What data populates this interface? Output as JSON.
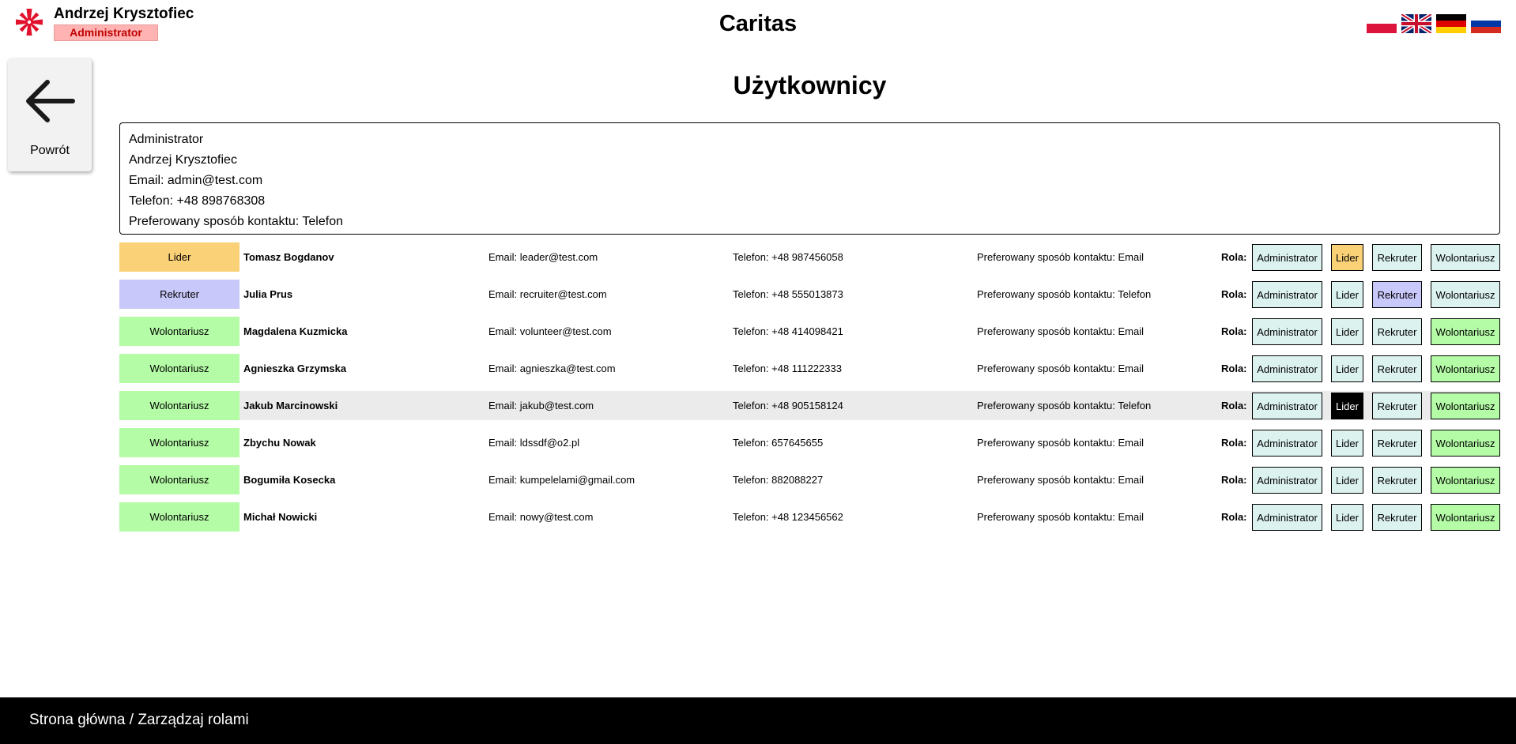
{
  "header": {
    "user_name": "Andrzej Krysztofiec",
    "user_role": "Administrator",
    "app_title": "Caritas",
    "languages": [
      "Polski",
      "English",
      "Deutsch",
      "Русский"
    ]
  },
  "back": {
    "label": "Powrót"
  },
  "page_title": "Użytkownicy",
  "current_user": {
    "role": "Administrator",
    "name": "Andrzej Krysztofiec",
    "email": "Email: admin@test.com",
    "phone": "Telefon: +48 898768308",
    "preferred": "Preferowany sposób kontaktu: Telefon"
  },
  "role_buttons": {
    "admin": "Administrator",
    "lider": "Lider",
    "rekruter": "Rekruter",
    "wolontariusz": "Wolontariusz"
  },
  "rola_label": "Rola:",
  "users": [
    {
      "role": "Lider",
      "name": "Tomasz Bogdanov",
      "email": "Email: leader@test.com",
      "phone": "Telefon: +48 987456058",
      "preferred": "Preferowany sposób kontaktu: Email"
    },
    {
      "role": "Rekruter",
      "name": "Julia Prus",
      "email": "Email: recruiter@test.com",
      "phone": "Telefon: +48 555013873",
      "preferred": "Preferowany sposób kontaktu: Telefon"
    },
    {
      "role": "Wolontariusz",
      "name": "Magdalena Kuzmicka",
      "email": "Email: volunteer@test.com",
      "phone": "Telefon: +48 414098421",
      "preferred": "Preferowany sposób kontaktu: Email"
    },
    {
      "role": "Wolontariusz",
      "name": "Agnieszka Grzymska",
      "email": "Email: agnieszka@test.com",
      "phone": "Telefon: +48 111222333",
      "preferred": "Preferowany sposób kontaktu: Email"
    },
    {
      "role": "Wolontariusz",
      "name": "Jakub Marcinowski",
      "email": "Email: jakub@test.com",
      "phone": "Telefon: +48 905158124",
      "preferred": "Preferowany sposób kontaktu: Telefon"
    },
    {
      "role": "Wolontariusz",
      "name": "Zbychu Nowak",
      "email": "Email: ldssdf@o2.pl",
      "phone": "Telefon: 657645655",
      "preferred": "Preferowany sposób kontaktu: Email"
    },
    {
      "role": "Wolontariusz",
      "name": "Bogumiła Kosecka",
      "email": "Email: kumpelelami@gmail.com",
      "phone": "Telefon: 882088227",
      "preferred": "Preferowany sposób kontaktu: Email"
    },
    {
      "role": "Wolontariusz",
      "name": "Michał Nowicki",
      "email": "Email: nowy@test.com",
      "phone": "Telefon: +48 123456562",
      "preferred": "Preferowany sposób kontaktu: Email"
    }
  ],
  "colors": {
    "lider": "#fad177",
    "rekruter": "#c9c8fb",
    "wolontariusz": "#b4fca6",
    "button_default": "#dcf2ef",
    "admin_badge": "#ffb3b3",
    "logo_red": "#e2122c"
  },
  "footer": {
    "crumbs": [
      "Strona główna",
      "Zarządzaj rolami"
    ],
    "separator": " / "
  }
}
